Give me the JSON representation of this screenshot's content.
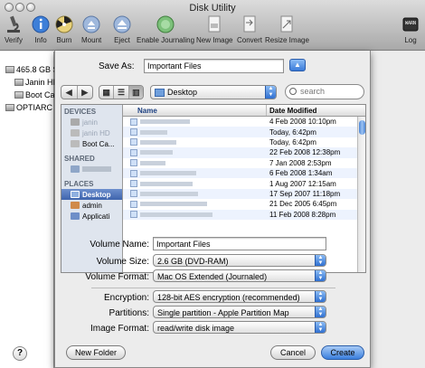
{
  "window": {
    "title": "Disk Utility"
  },
  "toolbar": {
    "items": [
      {
        "label": "Verify",
        "icon": "microscope-icon"
      },
      {
        "label": "Info",
        "icon": "info-icon"
      },
      {
        "label": "Burn",
        "icon": "burn-icon"
      },
      {
        "label": "Mount",
        "icon": "mount-icon"
      },
      {
        "label": "Eject",
        "icon": "eject-icon"
      },
      {
        "label": "Enable Journaling",
        "icon": "journal-icon"
      },
      {
        "label": "New Image",
        "icon": "new-image-icon"
      },
      {
        "label": "Convert",
        "icon": "convert-icon"
      },
      {
        "label": "Resize Image",
        "icon": "resize-icon"
      },
      {
        "label": "Log",
        "icon": "log-icon"
      }
    ]
  },
  "disk_list": [
    {
      "label": "465.8 GB S"
    },
    {
      "label": "Janin HD"
    },
    {
      "label": "Boot Ca"
    },
    {
      "label": "OPTIARC D"
    }
  ],
  "help": {
    "label": "?"
  },
  "save_sheet": {
    "save_as_label": "Save As:",
    "save_as_value": "Important Files",
    "location": "Desktop",
    "search_placeholder": "search",
    "sidebar": {
      "devices_header": "DEVICES",
      "devices": [
        "janin",
        "janin HD",
        "Boot Ca..."
      ],
      "shared_header": "SHARED",
      "shared": [
        " "
      ],
      "places_header": "PLACES",
      "places": [
        "Desktop",
        "admin",
        "Applicati"
      ]
    },
    "columns": {
      "name": "Name",
      "date": "Date Modified"
    },
    "files": [
      {
        "name": "",
        "date": "4 Feb 2008 10:10pm"
      },
      {
        "name": "",
        "date": "Today, 6:42pm"
      },
      {
        "name": "",
        "date": "Today, 6:42pm"
      },
      {
        "name": "",
        "date": "22 Feb 2008 12:38pm"
      },
      {
        "name": "",
        "date": "7 Jan 2008 2:53pm"
      },
      {
        "name": "",
        "date": "6 Feb 2008 1:34am"
      },
      {
        "name": "",
        "date": "1 Aug 2007 12:15am"
      },
      {
        "name": "",
        "date": "17 Sep 2007 11:18pm"
      },
      {
        "name": "",
        "date": "21 Dec 2005 6:45pm"
      },
      {
        "name": "",
        "date": "11 Feb 2008 8:28pm"
      }
    ],
    "options": {
      "volume_name_label": "Volume Name:",
      "volume_name_value": "Important Files",
      "volume_size_label": "Volume Size:",
      "volume_size_value": "2.6 GB (DVD-RAM)",
      "volume_format_label": "Volume Format:",
      "volume_format_value": "Mac OS Extended (Journaled)",
      "encryption_label": "Encryption:",
      "encryption_value": "128-bit AES encryption (recommended)",
      "partitions_label": "Partitions:",
      "partitions_value": "Single partition - Apple Partition Map",
      "image_format_label": "Image Format:",
      "image_format_value": "read/write disk image"
    },
    "buttons": {
      "new_folder": "New Folder",
      "cancel": "Cancel",
      "create": "Create"
    }
  },
  "colors": {
    "accent": "#3a7fde",
    "selection": "#3e64ad",
    "sidebar_bg": "#dfe5ee"
  }
}
